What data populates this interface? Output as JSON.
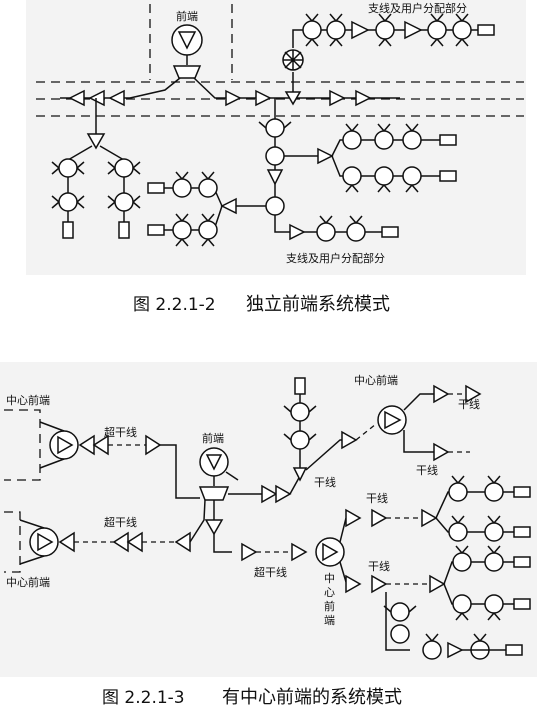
{
  "figure1": {
    "headend_label": "前端",
    "branch_label_top": "支线及用户分配部分",
    "branch_label_bottom": "支线及用户分配部分",
    "caption_number": "图 2.2.1-2",
    "caption_title": "独立前端系统模式"
  },
  "figure2": {
    "center_headend_tl": "中心前端",
    "center_headend_bl": "中心前端",
    "center_headend_tr": "中心前端",
    "center_headend_mid": [
      "中",
      "心",
      "前",
      "端"
    ],
    "headend_label": "前端",
    "super_trunk_1": "超干线",
    "super_trunk_2": "超干线",
    "super_trunk_3": "超干线",
    "trunk_1": "干线",
    "trunk_2": "干线",
    "trunk_3": "干线",
    "trunk_4": "干线",
    "trunk_5": "干线",
    "caption_number": "图 2.2.1-3",
    "caption_title": "有中心前端的系统模式"
  }
}
